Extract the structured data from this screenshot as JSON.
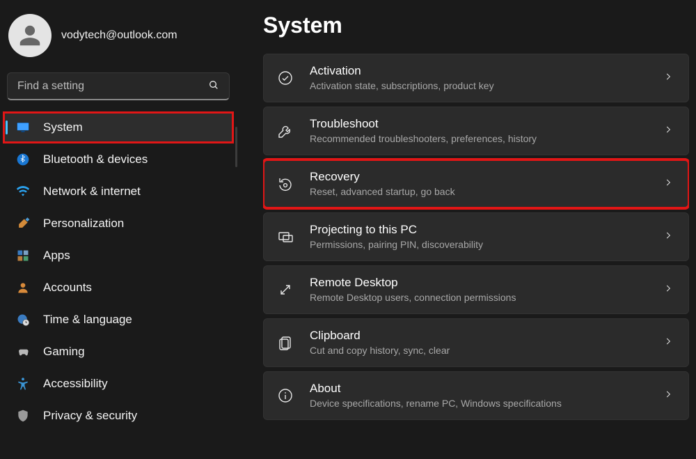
{
  "profile": {
    "email": "vodytech@outlook.com"
  },
  "search": {
    "placeholder": "Find a setting"
  },
  "sidebar": {
    "items": [
      {
        "label": "System",
        "active": true,
        "highlight": true,
        "icon": "monitor"
      },
      {
        "label": "Bluetooth & devices",
        "active": false,
        "highlight": false,
        "icon": "bluetooth"
      },
      {
        "label": "Network & internet",
        "active": false,
        "highlight": false,
        "icon": "wifi"
      },
      {
        "label": "Personalization",
        "active": false,
        "highlight": false,
        "icon": "brush"
      },
      {
        "label": "Apps",
        "active": false,
        "highlight": false,
        "icon": "apps"
      },
      {
        "label": "Accounts",
        "active": false,
        "highlight": false,
        "icon": "person"
      },
      {
        "label": "Time & language",
        "active": false,
        "highlight": false,
        "icon": "globe-clock"
      },
      {
        "label": "Gaming",
        "active": false,
        "highlight": false,
        "icon": "gamepad"
      },
      {
        "label": "Accessibility",
        "active": false,
        "highlight": false,
        "icon": "accessibility"
      },
      {
        "label": "Privacy & security",
        "active": false,
        "highlight": false,
        "icon": "shield"
      }
    ]
  },
  "page": {
    "title": "System"
  },
  "cards": [
    {
      "title": "Activation",
      "sub": "Activation state, subscriptions, product key",
      "icon": "check-circle",
      "highlight": false
    },
    {
      "title": "Troubleshoot",
      "sub": "Recommended troubleshooters, preferences, history",
      "icon": "wrench",
      "highlight": false
    },
    {
      "title": "Recovery",
      "sub": "Reset, advanced startup, go back",
      "icon": "recovery",
      "highlight": true
    },
    {
      "title": "Projecting to this PC",
      "sub": "Permissions, pairing PIN, discoverability",
      "icon": "project",
      "highlight": false
    },
    {
      "title": "Remote Desktop",
      "sub": "Remote Desktop users, connection permissions",
      "icon": "remote",
      "highlight": false
    },
    {
      "title": "Clipboard",
      "sub": "Cut and copy history, sync, clear",
      "icon": "clipboard",
      "highlight": false
    },
    {
      "title": "About",
      "sub": "Device specifications, rename PC, Windows specifications",
      "icon": "info",
      "highlight": false
    }
  ]
}
